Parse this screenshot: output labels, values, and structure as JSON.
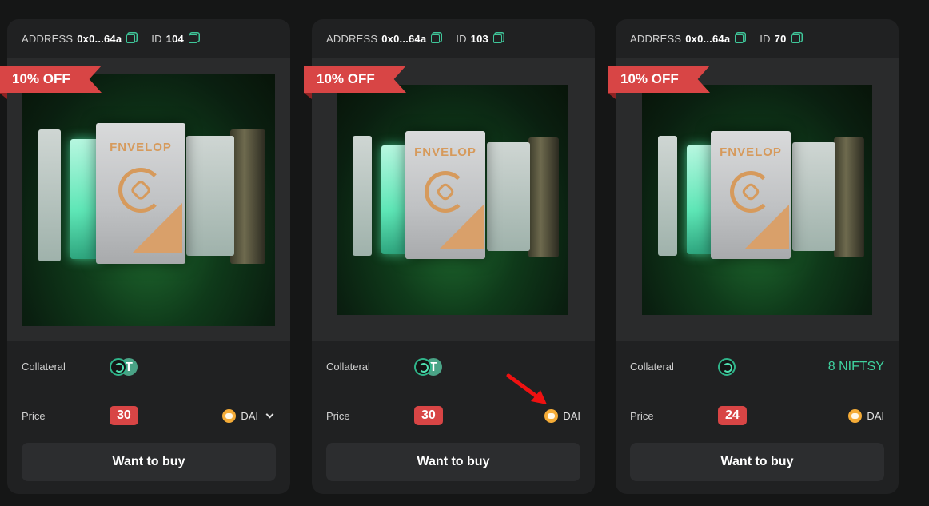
{
  "cards": [
    {
      "address_label": "ADDRESS",
      "address": "0x0...64a",
      "id_label": "ID",
      "id": "104",
      "discount": "10% OFF",
      "brand": "FNVELOP",
      "collateral_label": "Collateral",
      "collateral_icons": [
        "niftsy-icon",
        "tether-icon"
      ],
      "collateral_text": "",
      "price_label": "Price",
      "price": "30",
      "currency": "DAI",
      "has_dropdown": true,
      "button": "Want to buy"
    },
    {
      "address_label": "ADDRESS",
      "address": "0x0...64a",
      "id_label": "ID",
      "id": "103",
      "discount": "10% OFF",
      "brand": "FNVELOP",
      "collateral_label": "Collateral",
      "collateral_icons": [
        "niftsy-icon",
        "tether-icon"
      ],
      "collateral_text": "",
      "price_label": "Price",
      "price": "30",
      "currency": "DAI",
      "has_dropdown": false,
      "button": "Want to buy"
    },
    {
      "address_label": "ADDRESS",
      "address": "0x0...64a",
      "id_label": "ID",
      "id": "70",
      "discount": "10% OFF",
      "brand": "FNVELOP",
      "collateral_label": "Collateral",
      "collateral_icons": [
        "niftsy-icon"
      ],
      "collateral_text": "8 NIFTSY",
      "price_label": "Price",
      "price": "24",
      "currency": "DAI",
      "has_dropdown": false,
      "button": "Want to buy"
    }
  ],
  "colors": {
    "background": "#151616",
    "card": "#202122",
    "accent_red": "#d84545",
    "accent_green": "#3fd29f",
    "dai": "#f5ac37",
    "annotation_arrow": "#ee1111"
  },
  "annotation": {
    "icon": "red-arrow-icon",
    "points_to": "cards.1.currency"
  }
}
